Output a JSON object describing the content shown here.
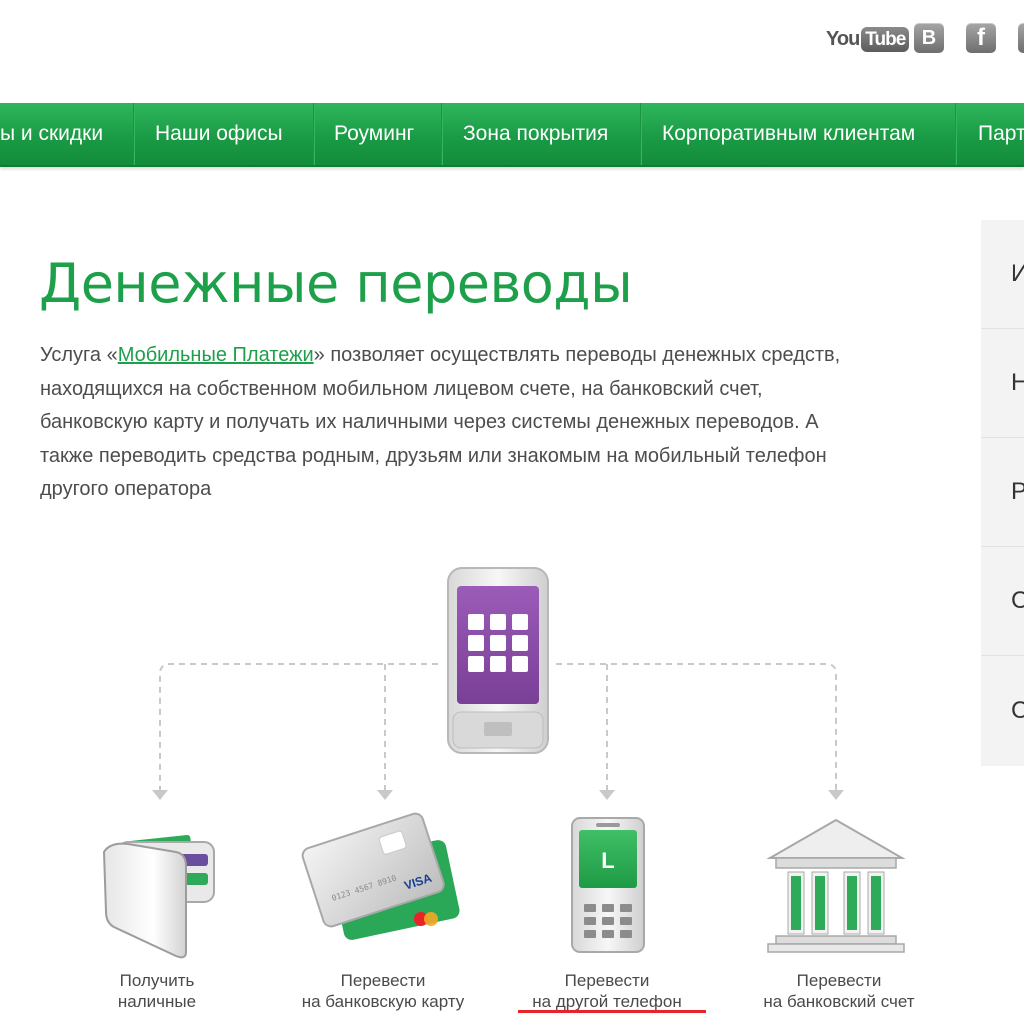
{
  "social": {
    "youtube_you": "You",
    "youtube_tube": "Tube",
    "vk_letter": "B",
    "fb_letter": "f"
  },
  "nav": {
    "items": [
      {
        "label": "ы и скидки"
      },
      {
        "label": "Наши офисы"
      },
      {
        "label": "Роуминг"
      },
      {
        "label": "Зона покрытия"
      },
      {
        "label": "Корпоративным клиентам"
      },
      {
        "label": "Парт"
      }
    ]
  },
  "sidebar": {
    "items": [
      {
        "label": "И"
      },
      {
        "label": "Н"
      },
      {
        "label": "Р"
      },
      {
        "label": "С"
      },
      {
        "label": "С"
      }
    ]
  },
  "main": {
    "title": "Денежные переводы",
    "desc": {
      "prefix": "Услуга «",
      "link": "Мобильные Платежи",
      "line1_rest": "» позволяет осуществлять переводы денежных средств,",
      "line2": "находящихся на собственном мобильном лицевом счете, на банковский счет,",
      "line3": "банковскую карту и получать их наличными через системы денежных переводов. А",
      "line4": "также переводить средства родным, друзьям или знакомым на мобильный телефон",
      "line5": "другого оператора"
    }
  },
  "options": [
    {
      "line1": "Получить",
      "line2": "наличные",
      "icon": "wallet-icon"
    },
    {
      "line1": "Перевести",
      "line2": "на банковскую карту",
      "icon": "bank-card-icon",
      "card_brand": "VISA"
    },
    {
      "line1": "Перевести",
      "line2": "на другой телефон",
      "icon": "mobile-phone-icon",
      "screen_letter": "L"
    },
    {
      "line1": "Перевести",
      "line2": "на банковский счет",
      "icon": "bank-building-icon"
    }
  ],
  "colors": {
    "brand_green": "#1ea04b",
    "phone_screen_purple": "#8a4ea6",
    "highlight_red": "#e8232a"
  }
}
